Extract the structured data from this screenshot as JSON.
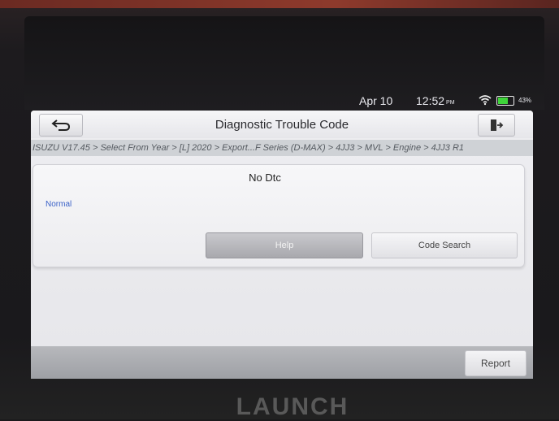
{
  "status_bar": {
    "date": "Apr 10",
    "time": "12:52",
    "ampm": "PM",
    "battery_pct": "43%",
    "icons": [
      "wifi-icon",
      "battery-icon"
    ]
  },
  "header": {
    "title": "Diagnostic Trouble Code",
    "back_icon": "back-arrow-icon",
    "exit_icon": "exit-icon"
  },
  "breadcrumb": "ISUZU V17.45 > Select From Year > [L] 2020 > Export...F Series (D-MAX) > 4JJ3 > MVL > Engine > 4JJ3 R1",
  "panel": {
    "message": "No Dtc",
    "status": "Normal",
    "help_label": "Help",
    "code_search_label": "Code Search"
  },
  "footer": {
    "report_label": "Report"
  },
  "device": {
    "brand": "LAUNCH"
  },
  "colors": {
    "status_text": "#3b62c8",
    "battery": "#3fd53a"
  }
}
